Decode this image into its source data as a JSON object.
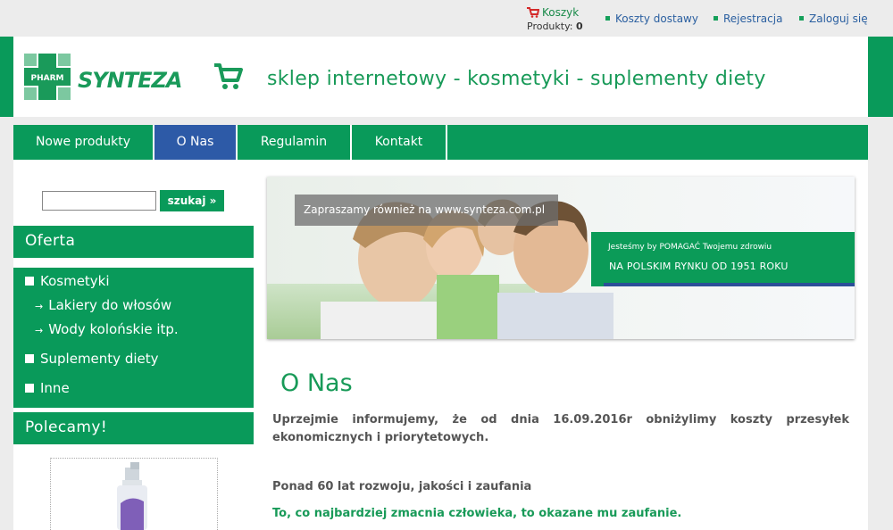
{
  "topbar": {
    "cart_label": "Koszyk",
    "cart_products_label": "Produkty:",
    "cart_products_count": "0",
    "links": [
      "Koszty dostawy",
      "Rejestracja",
      "Zaloguj się"
    ]
  },
  "header": {
    "logo_badge_text": "PHARM",
    "logo_brand_text": "SYNTEZA",
    "tagline": "sklep internetowy - kosmetyki - suplementy diety"
  },
  "nav": {
    "tabs": [
      {
        "label": "Nowe produkty",
        "active": false
      },
      {
        "label": "O Nas",
        "active": true
      },
      {
        "label": "Regulamin",
        "active": false
      },
      {
        "label": "Kontakt",
        "active": false
      }
    ]
  },
  "sidebar": {
    "search_placeholder": "",
    "search_button": "szukaj »",
    "offer_title": "Oferta",
    "menu": {
      "cosmetics": "Kosmetyki",
      "hair_lacquers": "Lakiery do włosów",
      "colognes": "Wody kolońskie itp.",
      "supplements": "Suplementy diety",
      "other": "Inne"
    },
    "recommended_title": "Polecamy!"
  },
  "banner": {
    "overlay_text": "Zapraszamy również na www.synteza.com.pl",
    "line1": "Jesteśmy by POMAGAĆ Twojemu zdrowiu",
    "line2": "NA POLSKIM RYNKU OD 1951 ROKU"
  },
  "content": {
    "title": "O Nas",
    "paragraph1": "Uprzejmie informujemy, że od dnia 16.09.2016r obniżylimy koszty przesyłek ekonomicznych i priorytetowych.",
    "paragraph2": "Ponad 60 lat rozwoju, jakości i zaufania",
    "paragraph3": "To, co najbardziej zmacnia człowieka, to okazane mu zaufanie."
  },
  "colors": {
    "brand_green": "#099a5a",
    "active_tab_blue": "#2d5aa7",
    "link_blue": "#2a5fa0"
  }
}
